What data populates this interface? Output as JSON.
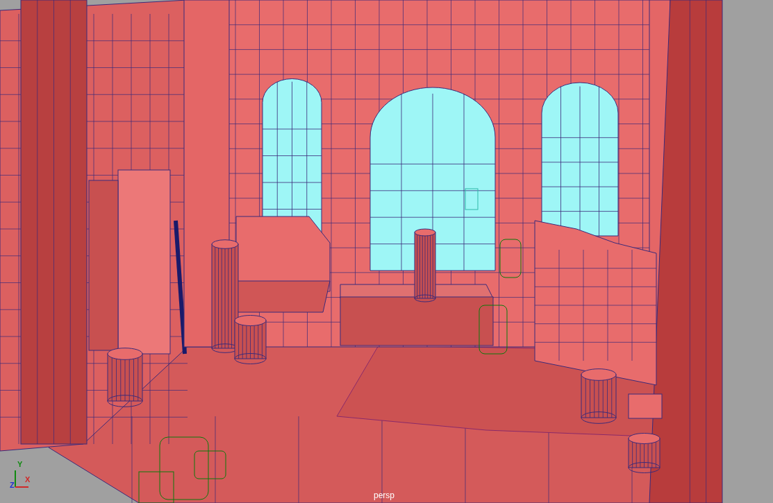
{
  "viewport": {
    "camera_label": "persp",
    "axes": [
      {
        "label": "Y",
        "color": "#0f8a0f"
      },
      {
        "label": "X",
        "color": "#d02828"
      },
      {
        "label": "Z",
        "color": "#2030d0"
      }
    ]
  }
}
